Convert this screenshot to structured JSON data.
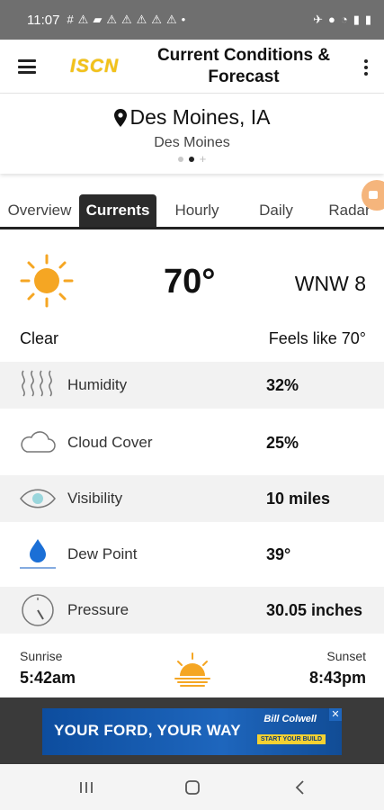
{
  "status_bar": {
    "time": "11:07",
    "icons": [
      "#",
      "⚠",
      "▰",
      "⚠",
      "⚠",
      "⚠",
      "⚠",
      "⚠",
      "•"
    ],
    "right_icons": [
      "✈",
      "●",
      "◔",
      "▮",
      "▮"
    ]
  },
  "app_bar": {
    "logo": "ISCN",
    "title": "Current Conditions & Forecast"
  },
  "location": {
    "city": "Des Moines, IA",
    "subtitle": "Des Moines",
    "page_plus": "+"
  },
  "tabs": [
    {
      "label": "Overview",
      "active": false
    },
    {
      "label": "Currents",
      "active": true
    },
    {
      "label": "Hourly",
      "active": false
    },
    {
      "label": "Daily",
      "active": false
    },
    {
      "label": "Radar",
      "active": false
    }
  ],
  "current": {
    "temperature": "70°",
    "wind": "WNW  8",
    "condition": "Clear",
    "feels_like": "Feels like 70°"
  },
  "details": [
    {
      "label": "Humidity",
      "value": "32%",
      "icon": "humidity-icon"
    },
    {
      "label": "Cloud Cover",
      "value": "25%",
      "icon": "cloud-icon"
    },
    {
      "label": "Visibility",
      "value": "10 miles",
      "icon": "eye-icon"
    },
    {
      "label": "Dew Point",
      "value": "39°",
      "icon": "droplet-icon"
    },
    {
      "label": "Pressure",
      "value": "30.05 inches",
      "icon": "gauge-icon"
    }
  ],
  "sun": {
    "sunrise_label": "Sunrise",
    "sunrise_time": "5:42am",
    "sunset_label": "Sunset",
    "sunset_time": "8:43pm"
  },
  "ad": {
    "headline": "YOUR FORD, YOUR WAY",
    "brand": "Bill Colwell",
    "cta": "START YOUR BUILD",
    "close": "✕"
  },
  "colors": {
    "sun": "#f5a623",
    "accent": "#f3c21a",
    "drop": "#1b6fd6",
    "tab_active": "#2b2b2b"
  }
}
